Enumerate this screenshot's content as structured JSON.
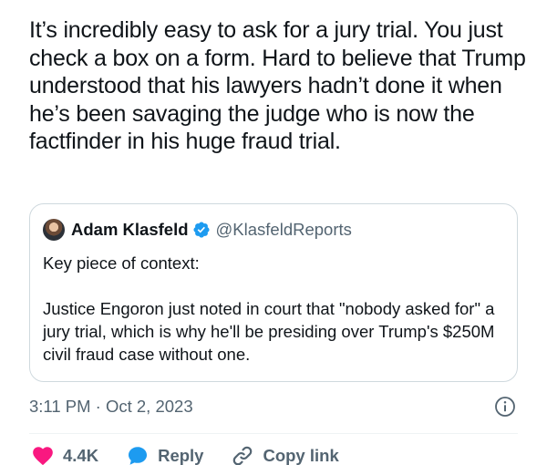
{
  "tweet": {
    "text": "It’s incredibly easy to ask for a jury trial. You just check a box on a form. Hard to believe that Trump understood that his lawyers hadn’t done it when he’s been savaging the judge who is now the factfinder in his huge fraud trial."
  },
  "quoted_tweet": {
    "author_name": "Adam Klasfeld",
    "author_handle": "@KlasfeldReports",
    "verified": true,
    "text": "Key piece of context:\n\nJustice Engoron just noted in court that \"nobody asked for\" a jury trial, which is why he'll be presiding over Trump's $250M civil fraud case without one."
  },
  "meta": {
    "timestamp": "3:11 PM · Oct 2, 2023"
  },
  "actions": {
    "like_count": "4.4K",
    "reply_label": "Reply",
    "copy_link_label": "Copy link"
  },
  "colors": {
    "like": "#f91880",
    "reply": "#1d9bf0",
    "verified": "#1d9bf0",
    "secondary_text": "#536471",
    "border": "#cfd9de"
  },
  "icons": [
    "verified-badge-icon",
    "info-icon",
    "heart-icon",
    "reply-bubble-icon",
    "link-icon"
  ]
}
